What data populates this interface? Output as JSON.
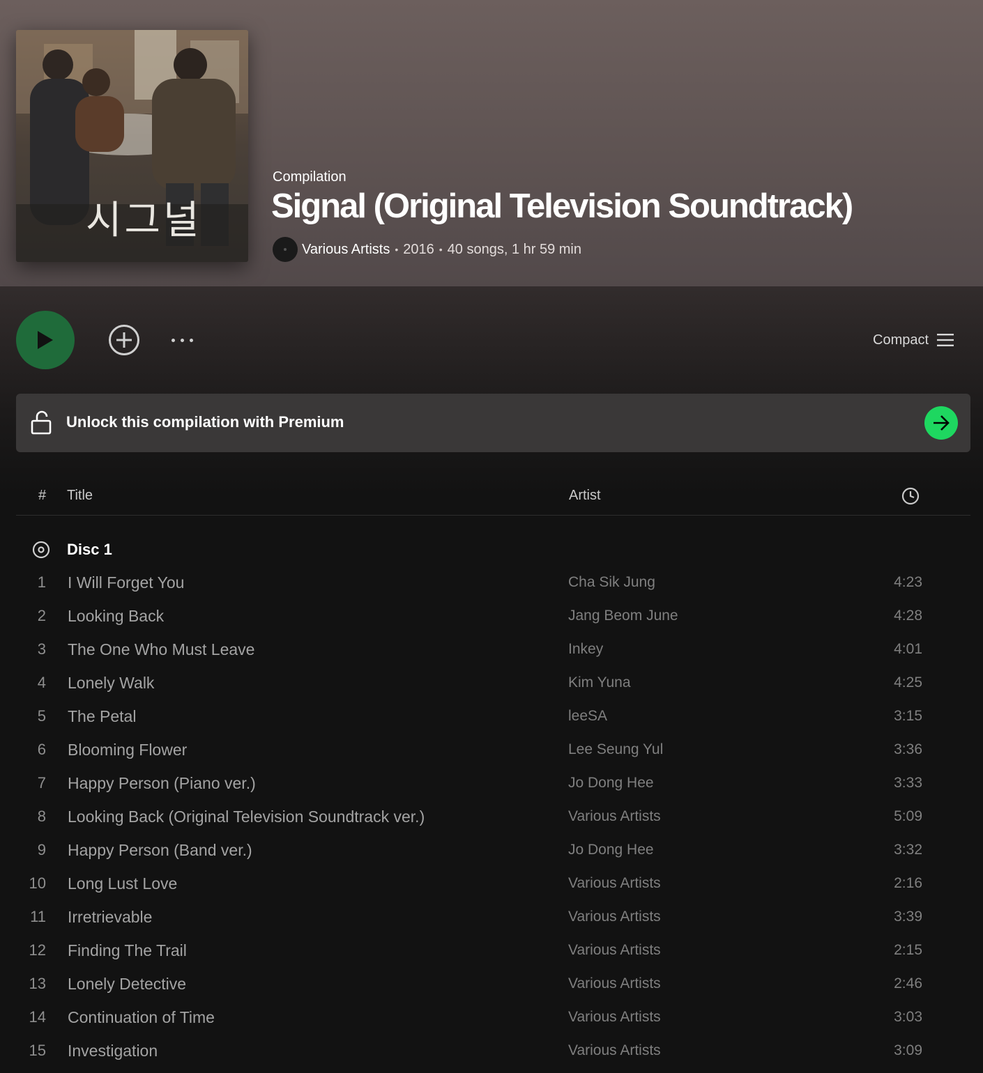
{
  "album": {
    "type": "Compilation",
    "title": "Signal (Original Television Soundtrack)",
    "artist": "Various Artists",
    "year": "2016",
    "stats": "40 songs, 1 hr 59 min",
    "cover_text": "시그널"
  },
  "controls": {
    "view_label": "Compact"
  },
  "banner": {
    "text": "Unlock this compilation with Premium"
  },
  "columns": {
    "number": "#",
    "title": "Title",
    "artist": "Artist"
  },
  "disc": {
    "label": "Disc 1"
  },
  "tracks": [
    {
      "num": "1",
      "title": "I Will Forget You",
      "artist": "Cha Sik Jung",
      "duration": "4:23"
    },
    {
      "num": "2",
      "title": "Looking Back",
      "artist": "Jang Beom June",
      "duration": "4:28"
    },
    {
      "num": "3",
      "title": "The One Who Must Leave",
      "artist": "Inkey",
      "duration": "4:01"
    },
    {
      "num": "4",
      "title": "Lonely Walk",
      "artist": "Kim Yuna",
      "duration": "4:25"
    },
    {
      "num": "5",
      "title": "The Petal",
      "artist": "leeSA",
      "duration": "3:15"
    },
    {
      "num": "6",
      "title": "Blooming Flower",
      "artist": "Lee Seung Yul",
      "duration": "3:36"
    },
    {
      "num": "7",
      "title": "Happy Person (Piano ver.)",
      "artist": "Jo Dong Hee",
      "duration": "3:33"
    },
    {
      "num": "8",
      "title": "Looking Back (Original Television Soundtrack ver.)",
      "artist": "Various Artists",
      "duration": "5:09"
    },
    {
      "num": "9",
      "title": "Happy Person (Band ver.)",
      "artist": "Jo Dong Hee",
      "duration": "3:32"
    },
    {
      "num": "10",
      "title": "Long Lust Love",
      "artist": "Various Artists",
      "duration": "2:16"
    },
    {
      "num": "11",
      "title": "Irretrievable",
      "artist": "Various Artists",
      "duration": "3:39"
    },
    {
      "num": "12",
      "title": "Finding The Trail",
      "artist": "Various Artists",
      "duration": "2:15"
    },
    {
      "num": "13",
      "title": "Lonely Detective",
      "artist": "Various Artists",
      "duration": "2:46"
    },
    {
      "num": "14",
      "title": "Continuation of Time",
      "artist": "Various Artists",
      "duration": "3:03"
    },
    {
      "num": "15",
      "title": "Investigation",
      "artist": "Various Artists",
      "duration": "3:09"
    }
  ],
  "colors": {
    "accent": "#1ed760",
    "play_button": "#1f6b3a",
    "header_top": "#6c5f5d",
    "background": "#121212"
  },
  "icons": {
    "play": "play-icon",
    "add": "add-circle-icon",
    "more": "more-dots-icon",
    "view": "list-icon",
    "lock": "unlock-icon",
    "arrow": "arrow-right-icon",
    "clock": "clock-icon",
    "disc": "disc-icon"
  }
}
